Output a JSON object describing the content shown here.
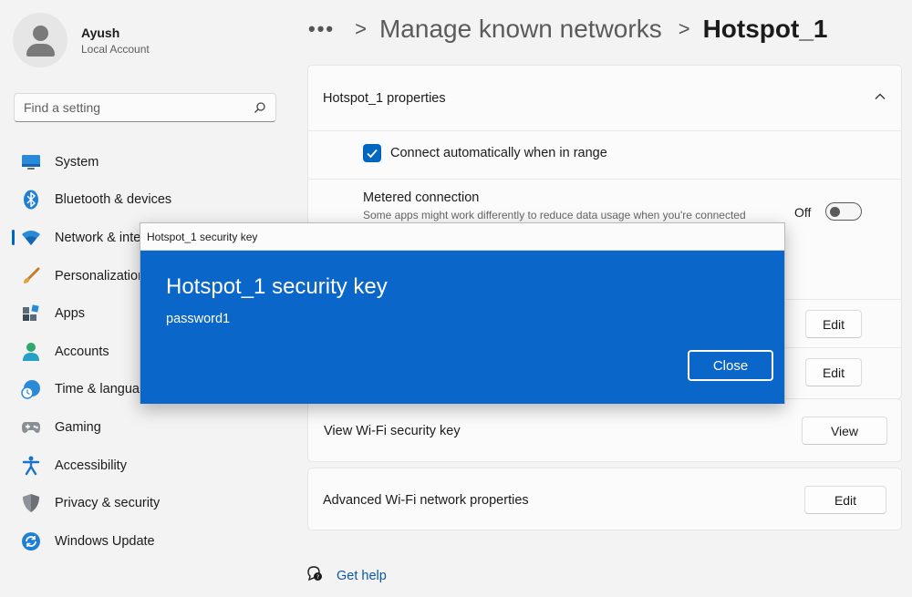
{
  "user": {
    "name": "Ayush",
    "account_type": "Local Account"
  },
  "search": {
    "placeholder": "Find a setting"
  },
  "nav": {
    "items": [
      {
        "label": "System",
        "icon": "monitor-icon"
      },
      {
        "label": "Bluetooth & devices",
        "icon": "bluetooth-icon"
      },
      {
        "label": "Network & internet",
        "icon": "wifi-icon",
        "active": true
      },
      {
        "label": "Personalization",
        "icon": "brush-icon"
      },
      {
        "label": "Apps",
        "icon": "apps-icon"
      },
      {
        "label": "Accounts",
        "icon": "person-icon"
      },
      {
        "label": "Time & language",
        "icon": "clock-globe-icon"
      },
      {
        "label": "Gaming",
        "icon": "gamepad-icon"
      },
      {
        "label": "Accessibility",
        "icon": "accessibility-icon"
      },
      {
        "label": "Privacy & security",
        "icon": "shield-icon"
      },
      {
        "label": "Windows Update",
        "icon": "update-icon"
      }
    ]
  },
  "breadcrumb": {
    "more": "•••",
    "sep": ">",
    "parent": "Manage known networks",
    "current": "Hotspot_1"
  },
  "properties": {
    "header": "Hotspot_1 properties",
    "connect_auto_label": "Connect automatically when in range",
    "connect_auto_checked": true,
    "metered_title": "Metered connection",
    "metered_subtitle": "Some apps might work differently to reduce data usage when you're connected",
    "metered_state": "Off",
    "edit_label_1": "Edit",
    "edit_label_2": "Edit"
  },
  "wifi_key": {
    "label": "View Wi-Fi security key",
    "button": "View"
  },
  "advanced": {
    "label": "Advanced Wi-Fi network properties",
    "button": "Edit"
  },
  "help": {
    "label": "Get help"
  },
  "dialog": {
    "title_bar": "Hotspot_1 security key",
    "heading": "Hotspot_1 security key",
    "key": "password1",
    "close_label": "Close"
  },
  "colors": {
    "accent": "#0067c0",
    "dialog_bg": "#0a67c9"
  }
}
